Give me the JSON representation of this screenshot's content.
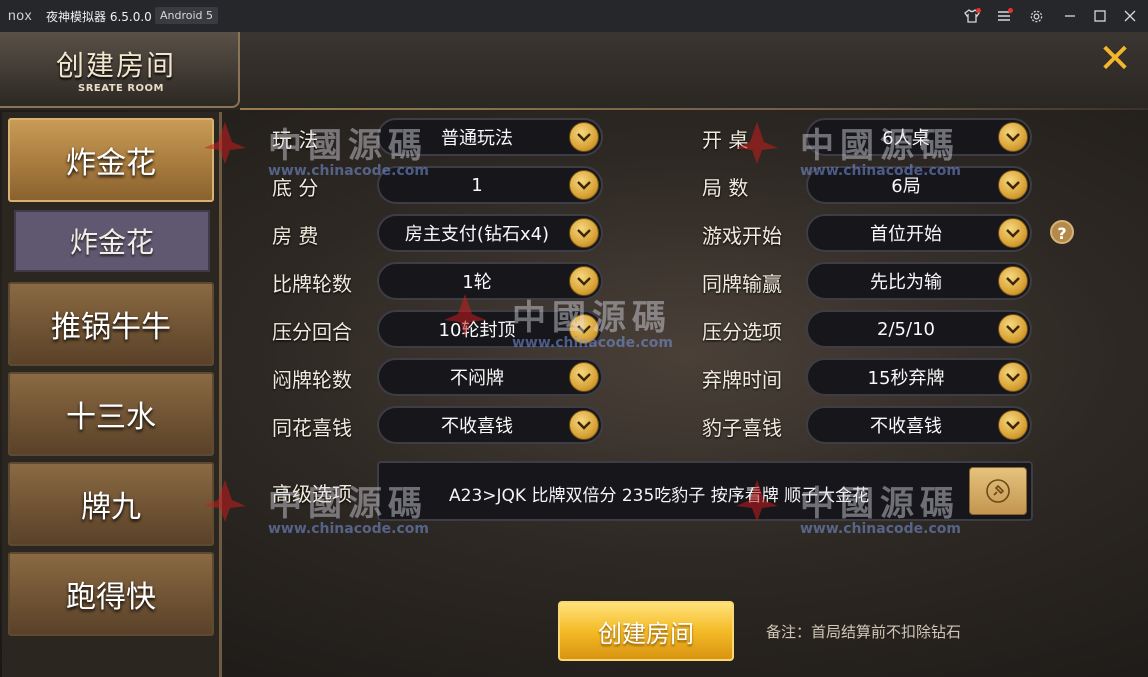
{
  "titlebar": {
    "logo": "nox",
    "app_title": "夜神模拟器 6.5.0.0",
    "android_badge": "Android 5",
    "icons": [
      "shirt-icon",
      "menu-icon",
      "gear-icon",
      "minimize-icon",
      "maximize-icon",
      "close-icon"
    ]
  },
  "header": {
    "title": "创建房间",
    "subtitle": "SREATE ROOM",
    "close_symbol": "✕"
  },
  "sidebar": {
    "items": [
      {
        "label": "炸金花",
        "active": true
      },
      {
        "label": "推锅牛牛",
        "active": false
      },
      {
        "label": "十三水",
        "active": false
      },
      {
        "label": "牌九",
        "active": false
      },
      {
        "label": "跑得快",
        "active": false
      }
    ],
    "sub_item": "炸金花"
  },
  "settings": {
    "left": [
      {
        "label": "玩  法",
        "value": "普通玩法"
      },
      {
        "label": "底   分",
        "value": "1"
      },
      {
        "label": "房   费",
        "value": "房主支付(钻石x4)"
      },
      {
        "label": "比牌轮数",
        "value": "1轮"
      },
      {
        "label": "压分回合",
        "value": "10轮封顶"
      },
      {
        "label": "闷牌轮数",
        "value": "不闷牌"
      },
      {
        "label": "同花喜钱",
        "value": "不收喜钱"
      }
    ],
    "right": [
      {
        "label": "开   桌",
        "value": "6人桌"
      },
      {
        "label": "局   数",
        "value": "6局"
      },
      {
        "label": "游戏开始",
        "value": "首位开始"
      },
      {
        "label": "同牌输赢",
        "value": "先比为输"
      },
      {
        "label": "压分选项",
        "value": "2/5/10"
      },
      {
        "label": "弃牌时间",
        "value": "15秒弃牌"
      },
      {
        "label": "豹子喜钱",
        "value": "不收喜钱"
      }
    ],
    "advanced_label": "高级选项",
    "advanced_value": "A23>JQK 比牌双倍分 235吃豹子 按序看牌 顺子大金花",
    "help_symbol": "?"
  },
  "actions": {
    "create_label": "创建房间",
    "note": "备注：首局结算前不扣除钻石"
  },
  "watermark": {
    "text": "中國源碼",
    "url": "www.chinacode.com"
  },
  "colors": {
    "gold_accent": "#f4bb27",
    "panel_dark": "#16161b",
    "sidebar_active": "#c89c55"
  }
}
